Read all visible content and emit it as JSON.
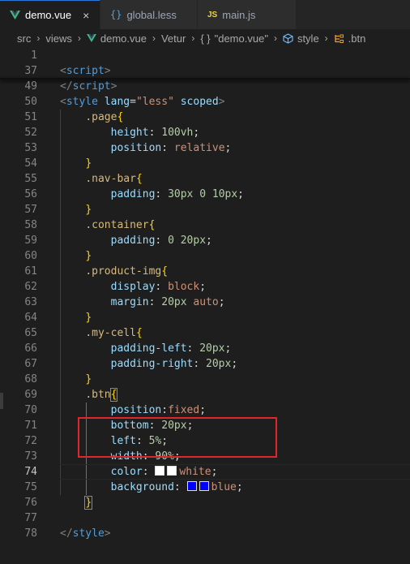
{
  "tabs": [
    {
      "label": "demo.vue",
      "icon": "vue-icon",
      "active": true,
      "close": "×"
    },
    {
      "label": "global.less",
      "icon": "less-braces-icon",
      "active": false,
      "close": ""
    },
    {
      "label": "main.js",
      "icon": "js-icon",
      "active": false,
      "close": ""
    }
  ],
  "icons": {
    "vue_glyph": "V",
    "less_glyph": "{}",
    "js_glyph": "JS",
    "chevron": "›"
  },
  "breadcrumb": {
    "items": [
      "src",
      "views",
      "demo.vue",
      "Vetur",
      "\"demo.vue\"",
      "style",
      ".btn"
    ],
    "braces_glyph": "{ }"
  },
  "editor": {
    "current_line": "74",
    "lines": [
      {
        "n": "1",
        "tokens": []
      },
      {
        "n": "37",
        "tokens": [
          {
            "c": "t-punc",
            "t": "<"
          },
          {
            "c": "t-tag",
            "t": "script"
          },
          {
            "c": "t-punc",
            "t": ">"
          }
        ]
      },
      {
        "n": "49",
        "tokens": [
          {
            "c": "t-punc",
            "t": "</"
          },
          {
            "c": "t-tag",
            "t": "script"
          },
          {
            "c": "t-punc",
            "t": ">"
          }
        ]
      },
      {
        "n": "50",
        "tokens": [
          {
            "c": "t-punc",
            "t": "<"
          },
          {
            "c": "t-tag",
            "t": "style"
          },
          {
            "c": "t-plain",
            "t": " "
          },
          {
            "c": "t-attr",
            "t": "lang"
          },
          {
            "c": "t-plain",
            "t": "="
          },
          {
            "c": "t-str",
            "t": "\"less\""
          },
          {
            "c": "t-plain",
            "t": " "
          },
          {
            "c": "t-attr",
            "t": "scoped"
          },
          {
            "c": "t-punc",
            "t": ">"
          }
        ]
      },
      {
        "n": "51",
        "tokens": [
          {
            "c": "t-plain",
            "t": "    "
          },
          {
            "c": "t-sel",
            "t": ".page"
          },
          {
            "c": "t-brace",
            "t": "{"
          }
        ]
      },
      {
        "n": "52",
        "tokens": [
          {
            "c": "t-plain",
            "t": "        "
          },
          {
            "c": "t-prop",
            "t": "height"
          },
          {
            "c": "t-plain",
            "t": ": "
          },
          {
            "c": "t-num",
            "t": "100vh"
          },
          {
            "c": "t-plain",
            "t": ";"
          }
        ]
      },
      {
        "n": "53",
        "tokens": [
          {
            "c": "t-plain",
            "t": "        "
          },
          {
            "c": "t-prop",
            "t": "position"
          },
          {
            "c": "t-plain",
            "t": ": "
          },
          {
            "c": "t-val",
            "t": "relative"
          },
          {
            "c": "t-plain",
            "t": ";"
          }
        ]
      },
      {
        "n": "54",
        "tokens": [
          {
            "c": "t-plain",
            "t": "    "
          },
          {
            "c": "t-brace",
            "t": "}"
          }
        ]
      },
      {
        "n": "55",
        "tokens": [
          {
            "c": "t-plain",
            "t": "    "
          },
          {
            "c": "t-sel",
            "t": ".nav-bar"
          },
          {
            "c": "t-brace",
            "t": "{"
          }
        ]
      },
      {
        "n": "56",
        "tokens": [
          {
            "c": "t-plain",
            "t": "        "
          },
          {
            "c": "t-prop",
            "t": "padding"
          },
          {
            "c": "t-plain",
            "t": ": "
          },
          {
            "c": "t-num",
            "t": "30px 0 10px"
          },
          {
            "c": "t-plain",
            "t": ";"
          }
        ]
      },
      {
        "n": "57",
        "tokens": [
          {
            "c": "t-plain",
            "t": "    "
          },
          {
            "c": "t-brace",
            "t": "}"
          }
        ]
      },
      {
        "n": "58",
        "tokens": [
          {
            "c": "t-plain",
            "t": "    "
          },
          {
            "c": "t-sel",
            "t": ".container"
          },
          {
            "c": "t-brace",
            "t": "{"
          }
        ]
      },
      {
        "n": "59",
        "tokens": [
          {
            "c": "t-plain",
            "t": "        "
          },
          {
            "c": "t-prop",
            "t": "padding"
          },
          {
            "c": "t-plain",
            "t": ": "
          },
          {
            "c": "t-num",
            "t": "0 20px"
          },
          {
            "c": "t-plain",
            "t": ";"
          }
        ]
      },
      {
        "n": "60",
        "tokens": [
          {
            "c": "t-plain",
            "t": "    "
          },
          {
            "c": "t-brace",
            "t": "}"
          }
        ]
      },
      {
        "n": "61",
        "tokens": [
          {
            "c": "t-plain",
            "t": "    "
          },
          {
            "c": "t-sel",
            "t": ".product-img"
          },
          {
            "c": "t-brace",
            "t": "{"
          }
        ]
      },
      {
        "n": "62",
        "tokens": [
          {
            "c": "t-plain",
            "t": "        "
          },
          {
            "c": "t-prop",
            "t": "display"
          },
          {
            "c": "t-plain",
            "t": ": "
          },
          {
            "c": "t-val",
            "t": "block"
          },
          {
            "c": "t-plain",
            "t": ";"
          }
        ]
      },
      {
        "n": "63",
        "tokens": [
          {
            "c": "t-plain",
            "t": "        "
          },
          {
            "c": "t-prop",
            "t": "margin"
          },
          {
            "c": "t-plain",
            "t": ": "
          },
          {
            "c": "t-num",
            "t": "20px"
          },
          {
            "c": "t-plain",
            "t": " "
          },
          {
            "c": "t-val",
            "t": "auto"
          },
          {
            "c": "t-plain",
            "t": ";"
          }
        ]
      },
      {
        "n": "64",
        "tokens": [
          {
            "c": "t-plain",
            "t": "    "
          },
          {
            "c": "t-brace",
            "t": "}"
          }
        ]
      },
      {
        "n": "65",
        "tokens": [
          {
            "c": "t-plain",
            "t": "    "
          },
          {
            "c": "t-sel",
            "t": ".my-cell"
          },
          {
            "c": "t-brace",
            "t": "{"
          }
        ]
      },
      {
        "n": "66",
        "tokens": [
          {
            "c": "t-plain",
            "t": "        "
          },
          {
            "c": "t-prop",
            "t": "padding-left"
          },
          {
            "c": "t-plain",
            "t": ": "
          },
          {
            "c": "t-num",
            "t": "20px"
          },
          {
            "c": "t-plain",
            "t": ";"
          }
        ]
      },
      {
        "n": "67",
        "tokens": [
          {
            "c": "t-plain",
            "t": "        "
          },
          {
            "c": "t-prop",
            "t": "padding-right"
          },
          {
            "c": "t-plain",
            "t": ": "
          },
          {
            "c": "t-num",
            "t": "20px"
          },
          {
            "c": "t-plain",
            "t": ";"
          }
        ]
      },
      {
        "n": "68",
        "tokens": [
          {
            "c": "t-plain",
            "t": "    "
          },
          {
            "c": "t-brace",
            "t": "}"
          }
        ]
      },
      {
        "n": "69",
        "tokens": [
          {
            "c": "t-plain",
            "t": "    "
          },
          {
            "c": "t-sel",
            "t": ".btn"
          },
          {
            "c": "t-brace",
            "t": "{",
            "m": 1
          }
        ]
      },
      {
        "n": "70",
        "tokens": [
          {
            "c": "t-plain",
            "t": "        "
          },
          {
            "c": "t-prop",
            "t": "position"
          },
          {
            "c": "t-plain",
            "t": ":"
          },
          {
            "c": "t-val",
            "t": "fixed"
          },
          {
            "c": "t-plain",
            "t": ";"
          }
        ]
      },
      {
        "n": "71",
        "tokens": [
          {
            "c": "t-plain",
            "t": "        "
          },
          {
            "c": "t-prop",
            "t": "bottom"
          },
          {
            "c": "t-plain",
            "t": ": "
          },
          {
            "c": "t-num",
            "t": "20px"
          },
          {
            "c": "t-plain",
            "t": ";"
          }
        ]
      },
      {
        "n": "72",
        "tokens": [
          {
            "c": "t-plain",
            "t": "        "
          },
          {
            "c": "t-prop",
            "t": "left"
          },
          {
            "c": "t-plain",
            "t": ": "
          },
          {
            "c": "t-num",
            "t": "5%"
          },
          {
            "c": "t-plain",
            "t": ";"
          }
        ]
      },
      {
        "n": "73",
        "tokens": [
          {
            "c": "t-plain",
            "t": "        "
          },
          {
            "c": "t-prop",
            "t": "width"
          },
          {
            "c": "t-plain",
            "t": ": "
          },
          {
            "c": "t-num",
            "t": "90%"
          },
          {
            "c": "t-plain",
            "t": ";"
          }
        ]
      },
      {
        "n": "74",
        "tokens": [
          {
            "c": "t-plain",
            "t": "        "
          },
          {
            "c": "t-prop",
            "t": "color"
          },
          {
            "c": "t-plain",
            "t": ": "
          },
          {
            "sw": "#ffffff"
          },
          {
            "sw": "#ffffff"
          },
          {
            "c": "t-val",
            "t": "white"
          },
          {
            "c": "t-plain",
            "t": ";"
          }
        ]
      },
      {
        "n": "75",
        "tokens": [
          {
            "c": "t-plain",
            "t": "        "
          },
          {
            "c": "t-prop",
            "t": "background"
          },
          {
            "c": "t-plain",
            "t": ": "
          },
          {
            "sw": "#0000ff"
          },
          {
            "sw": "#0000ff"
          },
          {
            "c": "t-val",
            "t": "blue"
          },
          {
            "c": "t-plain",
            "t": ";"
          }
        ]
      },
      {
        "n": "76",
        "tokens": [
          {
            "c": "t-plain",
            "t": "    "
          },
          {
            "c": "t-brace",
            "t": "}",
            "m": 1
          }
        ]
      },
      {
        "n": "77",
        "tokens": []
      },
      {
        "n": "78",
        "tokens": [
          {
            "c": "t-punc",
            "t": "</"
          },
          {
            "c": "t-tag",
            "t": "style"
          },
          {
            "c": "t-punc",
            "t": ">"
          }
        ]
      }
    ]
  }
}
